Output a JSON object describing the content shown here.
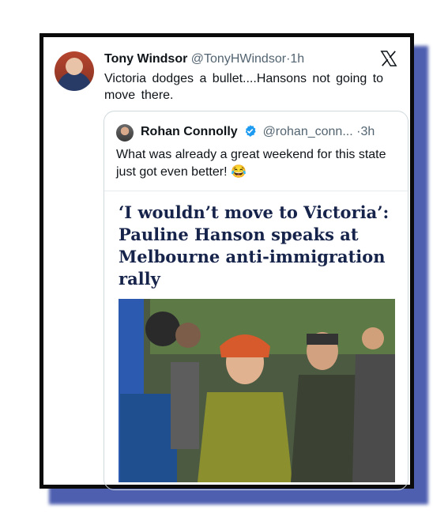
{
  "tweet": {
    "author_name": "Tony Windsor",
    "author_handle": "@TonyHWindsor",
    "separator": "·",
    "time": "1h",
    "text": "Victoria dodges a bullet....Hansons  not  going to  move  there."
  },
  "quoted_tweet": {
    "author_name": "Rohan Connolly",
    "author_handle": "@rohan_conn...",
    "separator": "·",
    "time": "3h",
    "text": "What was already a great weekend for this state just got even better! 😂",
    "article": {
      "headline": "‘I wouldn’t move to Victoria’: Pauline Hanson speaks at Melbourne anti-immigration rally"
    }
  },
  "icons": {
    "platform": "x-logo-icon",
    "verified": "verified-badge-icon"
  },
  "colors": {
    "frame_shadow": "#4e5fb0",
    "frame_border": "#0b0b0b",
    "verified": "#1d9bf0",
    "headline": "#16234a",
    "muted_text": "#536471"
  }
}
